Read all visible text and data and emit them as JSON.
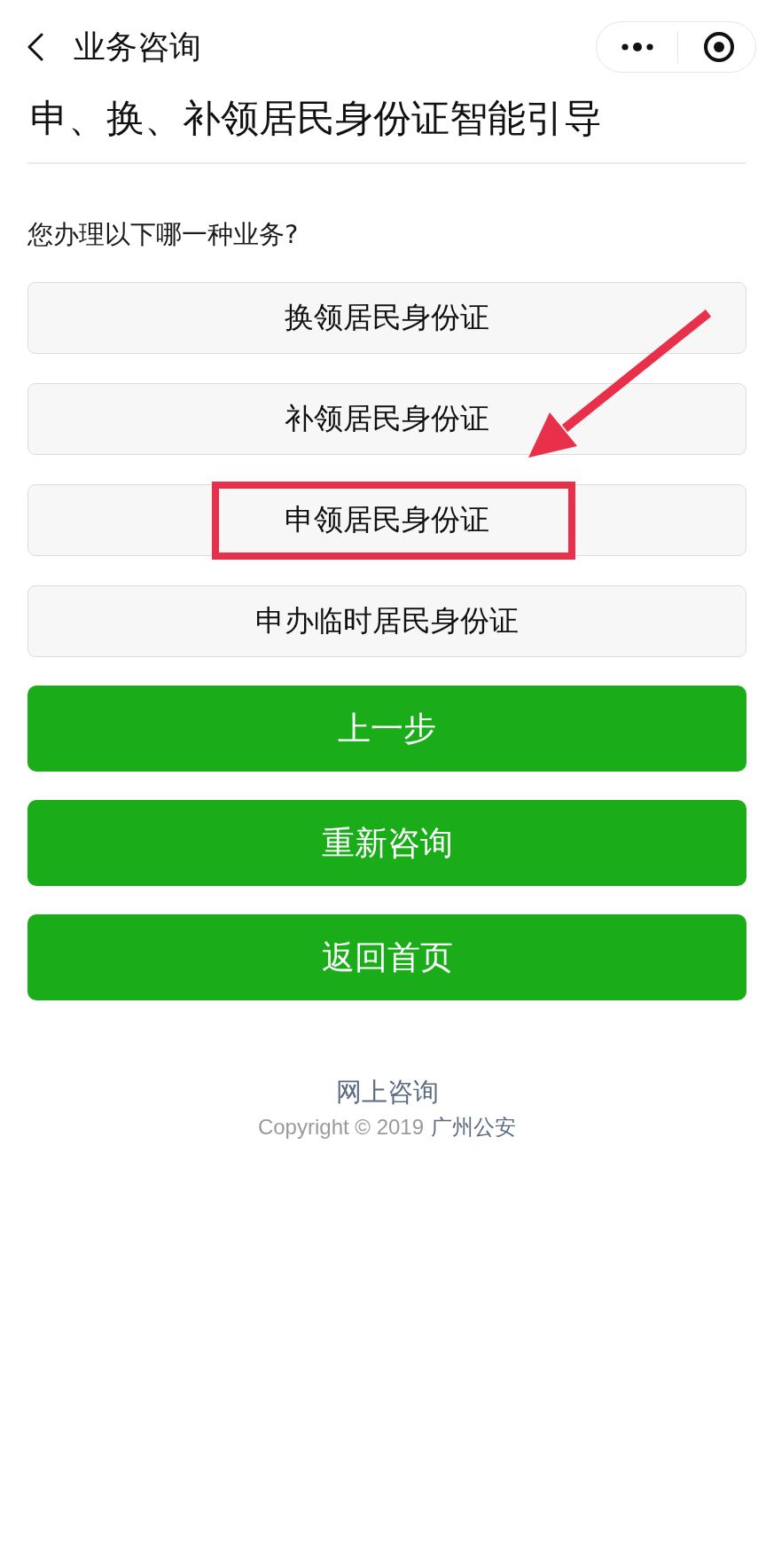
{
  "nav": {
    "title": "业务咨询"
  },
  "heading": "申、换、补领居民身份证智能引导",
  "question": "您办理以下哪一种业务?",
  "options": [
    {
      "label": "换领居民身份证",
      "highlighted": false
    },
    {
      "label": "补领居民身份证",
      "highlighted": false
    },
    {
      "label": "申领居民身份证",
      "highlighted": true
    },
    {
      "label": "申办临时居民身份证",
      "highlighted": false
    }
  ],
  "actions": [
    {
      "label": "上一步"
    },
    {
      "label": "重新咨询"
    },
    {
      "label": "返回首页"
    }
  ],
  "footer": {
    "link": "网上咨询",
    "copyright": "Copyright © 2019",
    "owner": "广州公安"
  }
}
